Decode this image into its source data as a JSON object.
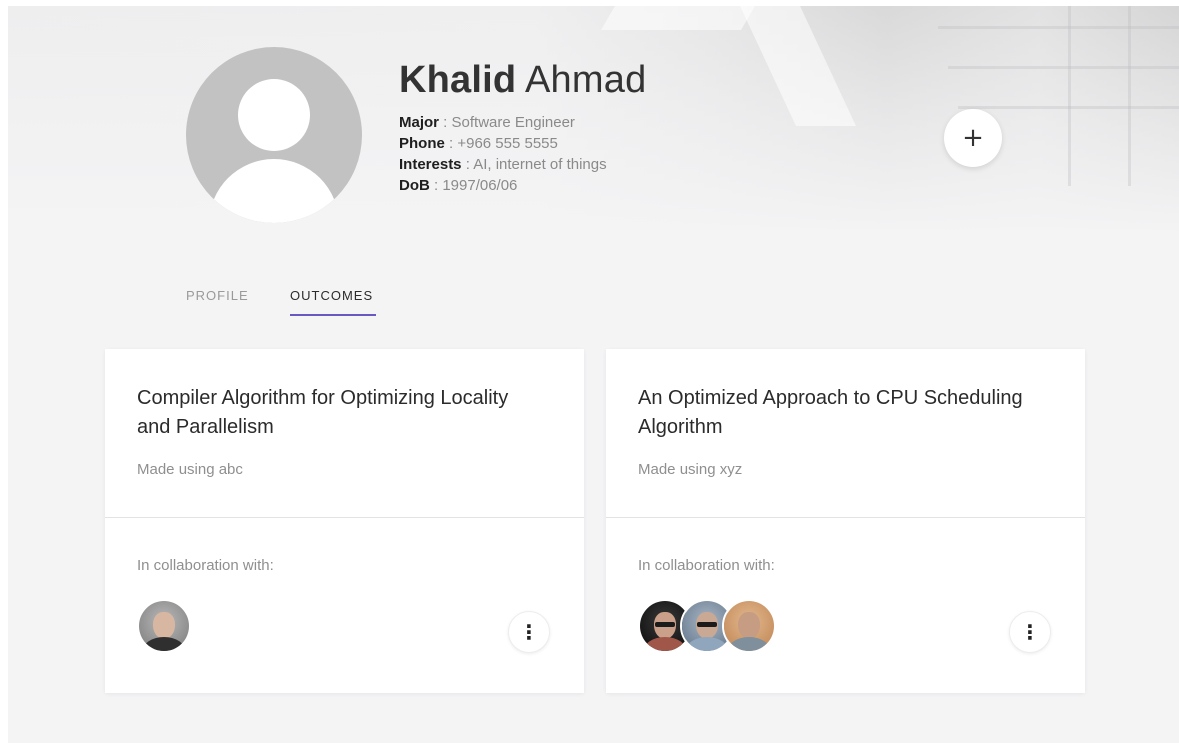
{
  "profile": {
    "first_name": "Khalid",
    "last_name": "Ahmad",
    "fields": [
      {
        "label": "Major",
        "value": " : Software Engineer"
      },
      {
        "label": "Phone",
        "value": " : +966 555 5555"
      },
      {
        "label": "Interests",
        "value": " : AI, internet of things"
      },
      {
        "label": "DoB",
        "value": " : 1997/06/06"
      }
    ],
    "add_label": "+"
  },
  "tabs": [
    {
      "label": "PROFILE",
      "active": false
    },
    {
      "label": "OUTCOMES",
      "active": true
    }
  ],
  "accent_color": "#6b57c2",
  "outcomes": [
    {
      "title": "Compiler Algorithm for Optimizing Locality and Parallelism",
      "made_using": "Made using abc",
      "collab_label": "In collaboration with:",
      "collaborators": [
        "collaborator-avatar-1"
      ],
      "menu_icon": "⋮"
    },
    {
      "title": "An Optimized Approach to CPU Scheduling Algorithm",
      "made_using": "Made using xyz",
      "collab_label": "In collaboration with:",
      "collaborators": [
        "collaborator-avatar-1",
        "collaborator-avatar-2",
        "collaborator-avatar-3"
      ],
      "menu_icon": "⋮"
    }
  ]
}
